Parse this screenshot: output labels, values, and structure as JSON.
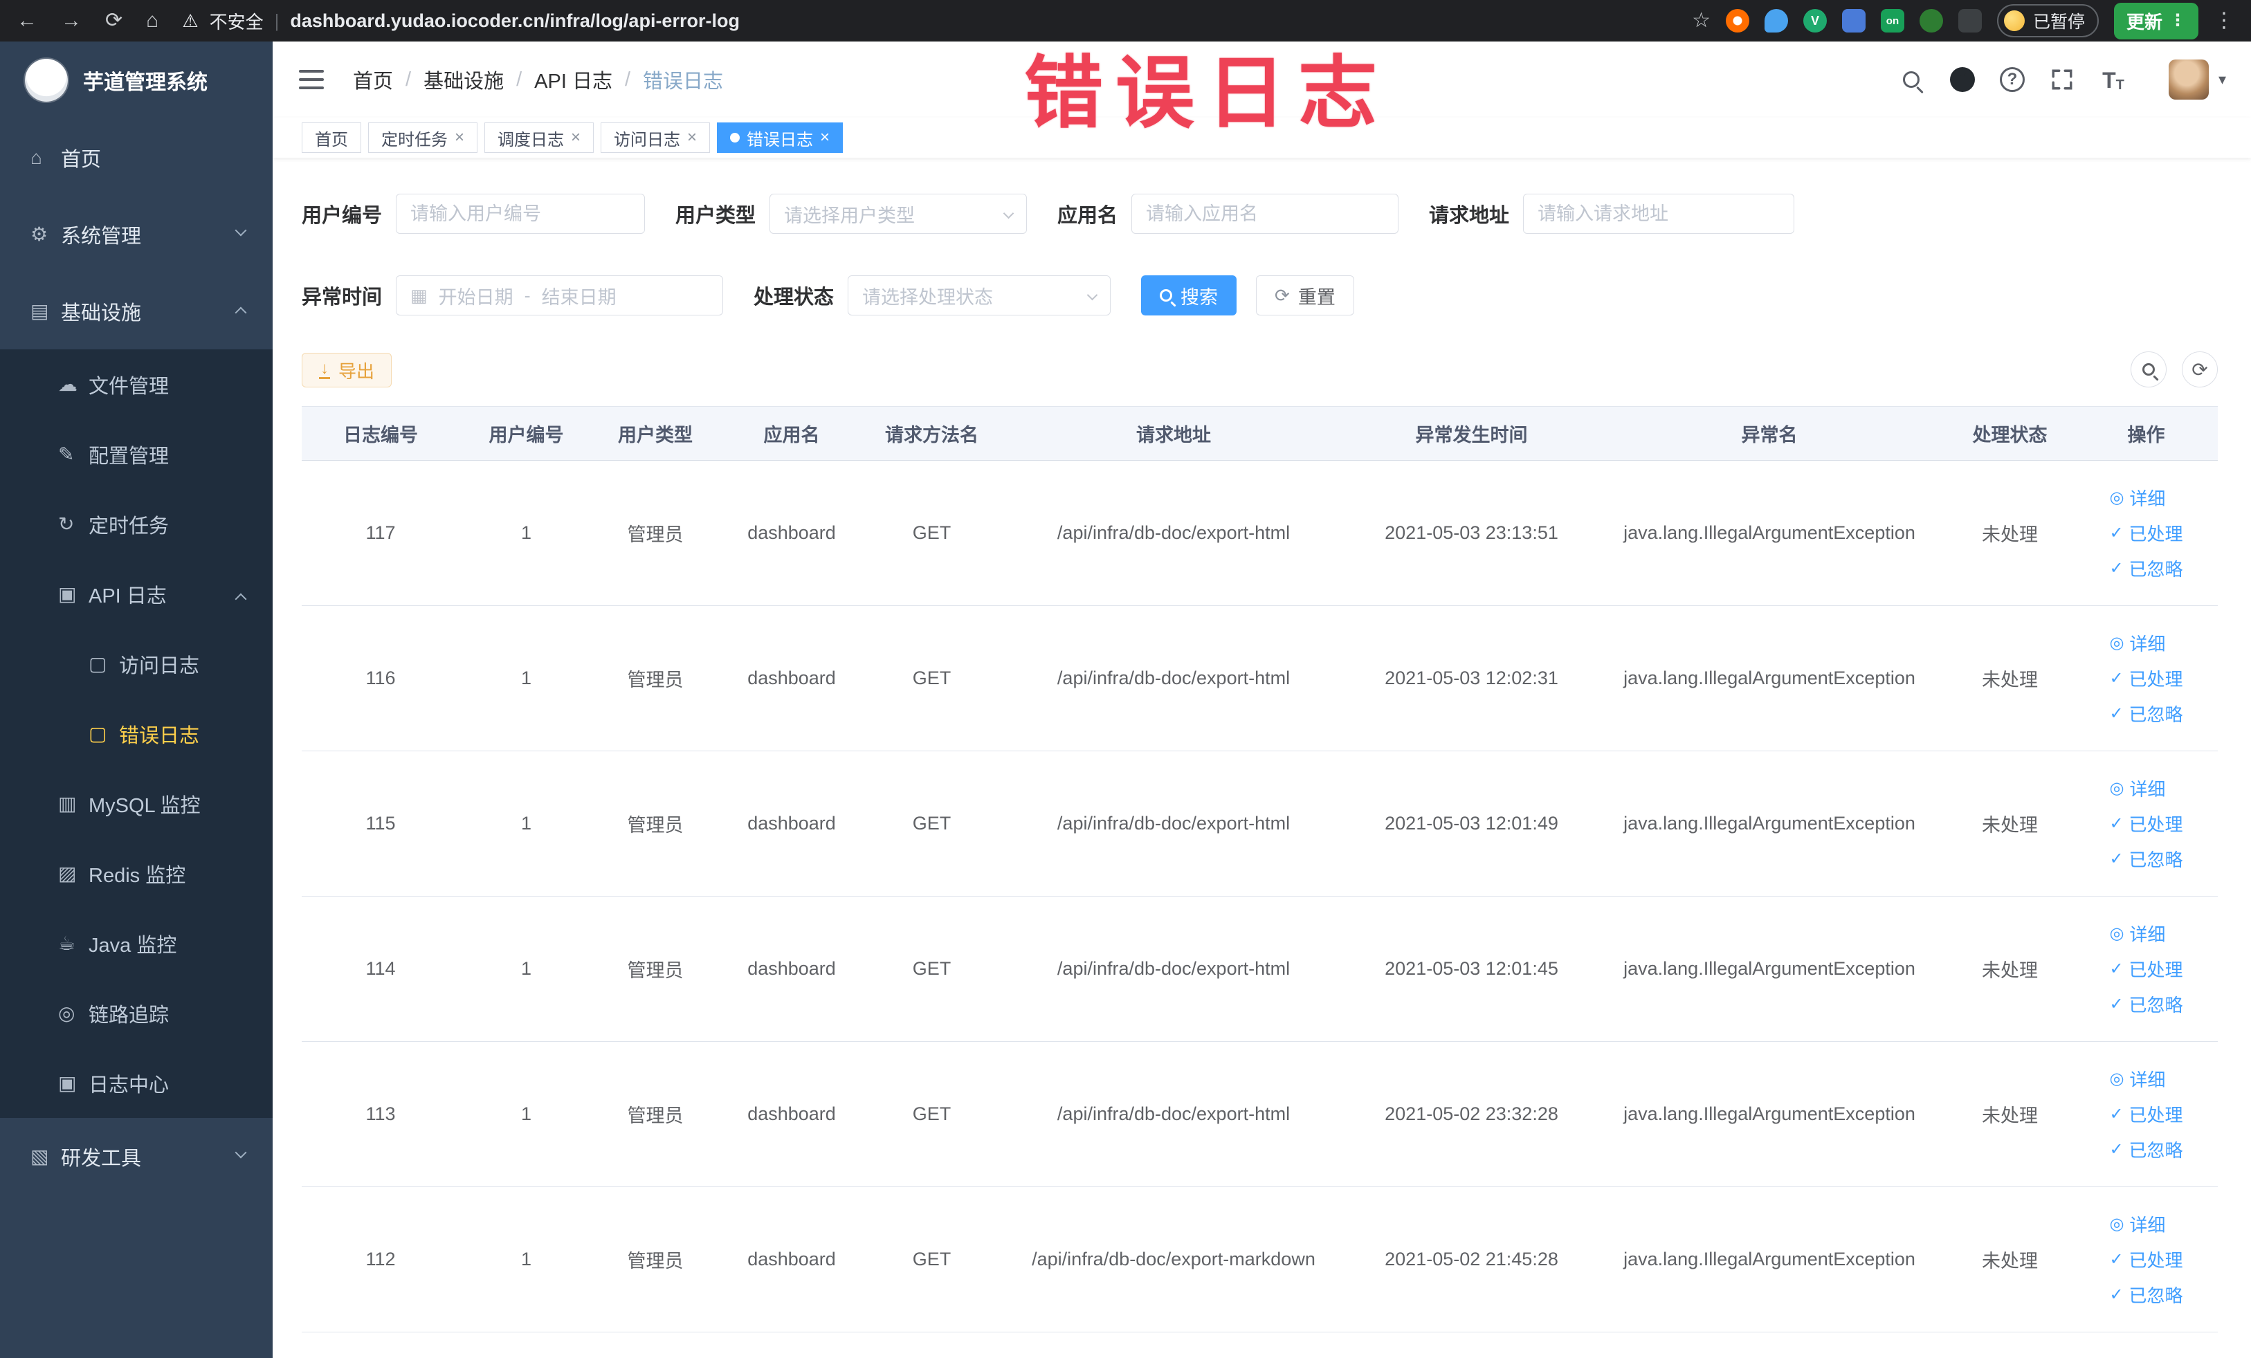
{
  "browser": {
    "security_text": "不安全",
    "url": "dashboard.yudao.iocoder.cn/infra/log/api-error-log",
    "ext_on_badge": "on",
    "ext_v": "V",
    "paused_badge": "已暂停",
    "update_button": "更新"
  },
  "icons": {
    "back": "←",
    "forward": "→",
    "reload": "⟳",
    "home": "⌂",
    "warning": "⚠",
    "star": "☆",
    "dots": "⋮",
    "caret_down": "▾",
    "menu_home": "⌂",
    "menu_system": "⚙",
    "menu_infra": "▤",
    "menu_file": "☁",
    "menu_config": "✎",
    "menu_job": "↻",
    "menu_api_log": "▣",
    "menu_access_log": "▢",
    "menu_error_log": "▢",
    "menu_mysql": "▥",
    "menu_redis": "▨",
    "menu_java": "☕",
    "menu_trace": "◎",
    "menu_log_center": "▣",
    "menu_dev": "▧",
    "question": "?",
    "calendar": "▦",
    "refresh": "⟳",
    "download": "↓",
    "detail": "◎",
    "check": "✓",
    "close": "×",
    "font_t": "T"
  },
  "sidebar": {
    "app_title": "芋道管理系统",
    "items": [
      {
        "label": "首页"
      },
      {
        "label": "系统管理"
      },
      {
        "label": "基础设施"
      },
      {
        "label": "文件管理"
      },
      {
        "label": "配置管理"
      },
      {
        "label": "定时任务"
      },
      {
        "label": "API 日志"
      },
      {
        "label": "访问日志"
      },
      {
        "label": "错误日志"
      },
      {
        "label": "MySQL 监控"
      },
      {
        "label": "Redis 监控"
      },
      {
        "label": "Java 监控"
      },
      {
        "label": "链路追踪"
      },
      {
        "label": "日志中心"
      },
      {
        "label": "研发工具"
      }
    ]
  },
  "header": {
    "breadcrumb": [
      "首页",
      "基础设施",
      "API 日志",
      "错误日志"
    ],
    "separator": "/"
  },
  "tabs": [
    {
      "label": "首页"
    },
    {
      "label": "定时任务"
    },
    {
      "label": "调度日志"
    },
    {
      "label": "访问日志"
    },
    {
      "label": "错误日志"
    }
  ],
  "annotation": {
    "text": "错误日志",
    "color": "#ee4256"
  },
  "filters": {
    "user_id_label": "用户编号",
    "user_id_placeholder": "请输入用户编号",
    "user_type_label": "用户类型",
    "user_type_placeholder": "请选择用户类型",
    "app_name_label": "应用名",
    "app_name_placeholder": "请输入应用名",
    "request_url_label": "请求地址",
    "request_url_placeholder": "请输入请求地址",
    "exception_time_label": "异常时间",
    "date_start_placeholder": "开始日期",
    "date_separator": "-",
    "date_end_placeholder": "结束日期",
    "process_status_label": "处理状态",
    "process_status_placeholder": "请选择处理状态",
    "search_label": "搜索",
    "reset_label": "重置"
  },
  "toolbar": {
    "export_label": "导出"
  },
  "table": {
    "columns": [
      "日志编号",
      "用户编号",
      "用户类型",
      "应用名",
      "请求方法名",
      "请求地址",
      "异常发生时间",
      "异常名",
      "处理状态",
      "操作"
    ],
    "actions": [
      "详细",
      "已处理",
      "已忽略"
    ],
    "rows": [
      {
        "id": "117",
        "user_id": "1",
        "user_type": "管理员",
        "app_name": "dashboard",
        "method": "GET",
        "url": "/api/infra/db-doc/export-html",
        "time": "2021-05-03 23:13:51",
        "exception": "java.lang.IllegalArgumentException",
        "status": "未处理"
      },
      {
        "id": "116",
        "user_id": "1",
        "user_type": "管理员",
        "app_name": "dashboard",
        "method": "GET",
        "url": "/api/infra/db-doc/export-html",
        "time": "2021-05-03 12:02:31",
        "exception": "java.lang.IllegalArgumentException",
        "status": "未处理"
      },
      {
        "id": "115",
        "user_id": "1",
        "user_type": "管理员",
        "app_name": "dashboard",
        "method": "GET",
        "url": "/api/infra/db-doc/export-html",
        "time": "2021-05-03 12:01:49",
        "exception": "java.lang.IllegalArgumentException",
        "status": "未处理"
      },
      {
        "id": "114",
        "user_id": "1",
        "user_type": "管理员",
        "app_name": "dashboard",
        "method": "GET",
        "url": "/api/infra/db-doc/export-html",
        "time": "2021-05-03 12:01:45",
        "exception": "java.lang.IllegalArgumentException",
        "status": "未处理"
      },
      {
        "id": "113",
        "user_id": "1",
        "user_type": "管理员",
        "app_name": "dashboard",
        "method": "GET",
        "url": "/api/infra/db-doc/export-html",
        "time": "2021-05-02 23:32:28",
        "exception": "java.lang.IllegalArgumentException",
        "status": "未处理"
      },
      {
        "id": "112",
        "user_id": "1",
        "user_type": "管理员",
        "app_name": "dashboard",
        "method": "GET",
        "url": "/api/infra/db-doc/export-markdown",
        "time": "2021-05-02 21:45:28",
        "exception": "java.lang.IllegalArgumentException",
        "status": "未处理"
      }
    ]
  }
}
